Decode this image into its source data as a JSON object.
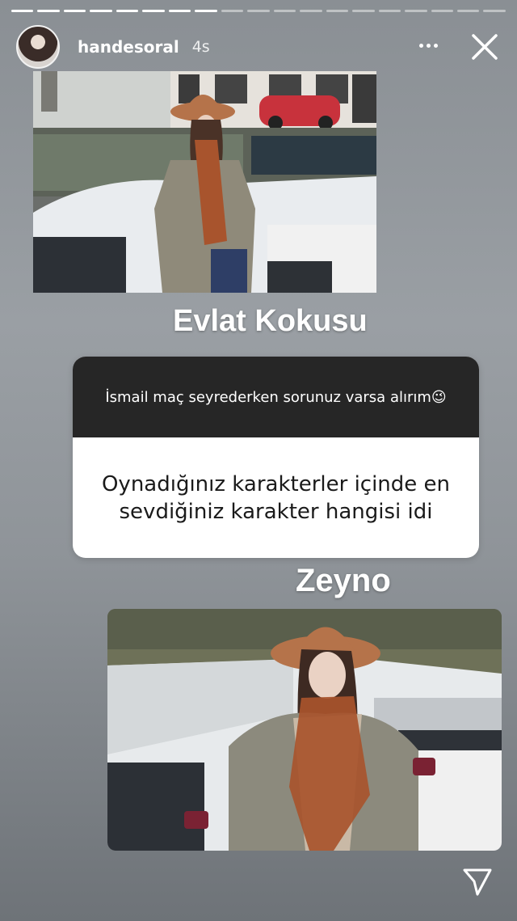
{
  "story": {
    "segments_total": 19,
    "segments_done": 8
  },
  "header": {
    "username": "handesoral",
    "time": "4s",
    "more_icon": "more-horizontal-icon",
    "close_icon": "close-icon"
  },
  "captions": {
    "first": "Evlat Kokusu",
    "second": "Zeyno"
  },
  "question_card": {
    "prompt": "İsmail maç seyrederken sorunuz varsa alırım😉",
    "question": "Oynadığınız karakterler içinde en sevdiğiniz karakter hangisi idi"
  },
  "footer": {
    "send_icon": "send-icon"
  },
  "colors": {
    "card_header": "#262626",
    "card_body": "#ffffff",
    "hat": "#b5734a",
    "scarf": "#a8542d",
    "car": "#c8323c"
  }
}
